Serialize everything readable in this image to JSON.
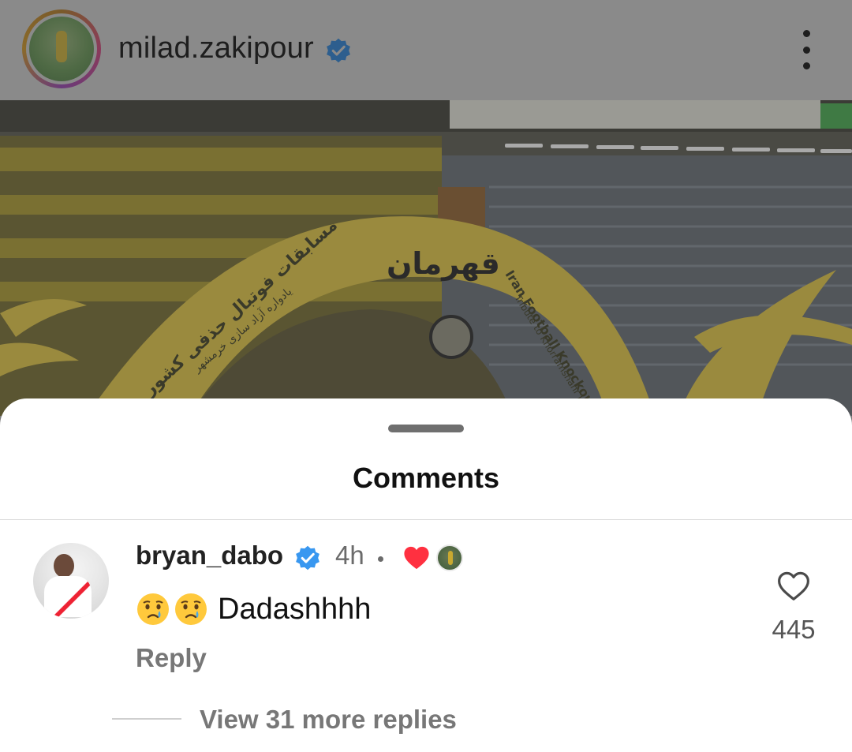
{
  "post": {
    "username": "milad.zakipour",
    "verified": true,
    "icons": {
      "menu": "more-vertical-icon",
      "verified": "verified-badge-icon"
    },
    "image": {
      "banner_text": "قهرمان",
      "arch_text_fa": "مسابقات فوتبال حذفی کشور",
      "arch_subtext_fa": "یادواره آزاد سازی خرمشهر",
      "arch_text_en": "Iran Football Knockout Com",
      "arch_subtext_en": "Tribute to Khorramshahr Lib"
    }
  },
  "sheet": {
    "title": "Comments"
  },
  "comments": [
    {
      "username": "bryan_dabo",
      "verified": true,
      "time": "4h",
      "liked_by_author": true,
      "text": "Dadashhhh",
      "emojis": [
        "crying-face-emoji",
        "crying-face-emoji"
      ],
      "reply_label": "Reply",
      "like_count": "445",
      "view_replies_label": "View 31 more replies"
    }
  ],
  "colors": {
    "accent_blue": "#3897f0",
    "heart_red": "#ff3040",
    "dim_overlay": "#8a8a8a"
  }
}
